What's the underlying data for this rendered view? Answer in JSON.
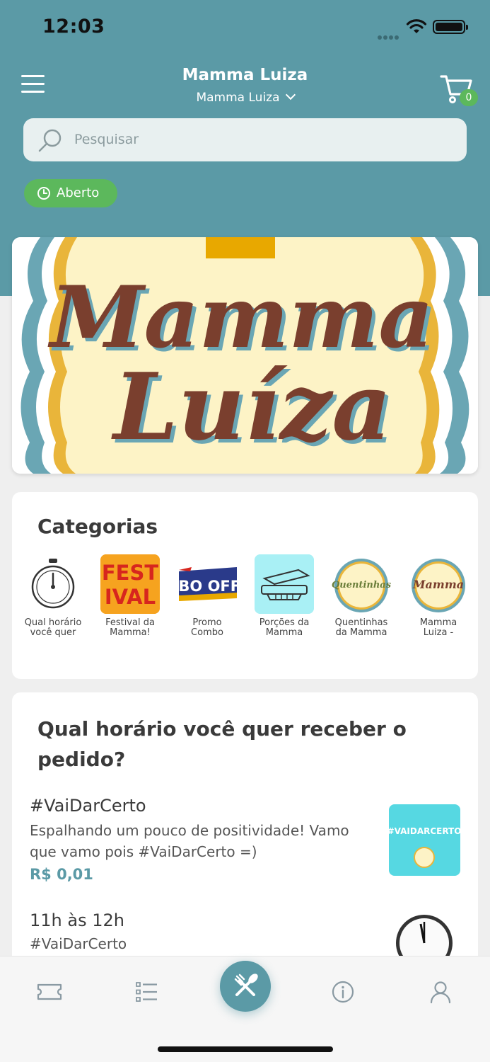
{
  "status_bar": {
    "time": "12:03"
  },
  "header": {
    "title": "Mamma Luiza",
    "store_name": "Mamma Luiza",
    "cart_count": "0"
  },
  "search": {
    "placeholder": "Pesquisar"
  },
  "status_badge": {
    "label": "Aberto"
  },
  "banner": {
    "line1": "Mamma",
    "line2": "Luíza"
  },
  "categories": {
    "title": "Categorias",
    "items": [
      {
        "label_line1": "Qual horário",
        "label_line2": "você quer",
        "icon": "clock-icon"
      },
      {
        "label_line1": "Festival da",
        "label_line2": "Mamma!",
        "icon": "festival-icon",
        "thumb_text1": "FEST",
        "thumb_text2": "IVAL"
      },
      {
        "label_line1": "Promo",
        "label_line2": "Combo",
        "icon": "combo-offer-icon",
        "thumb_text": "MBO OFFE"
      },
      {
        "label_line1": "Porções da",
        "label_line2": "Mamma",
        "icon": "food-container-icon"
      },
      {
        "label_line1": "Quentinhas",
        "label_line2": "da Mamma",
        "icon": "quentinhas-logo-icon",
        "thumb_text": "Quentinhas"
      },
      {
        "label_line1": "Mamma",
        "label_line2": "Luiza -",
        "icon": "mamma-luiza-logo-icon",
        "thumb_text": "Mamma"
      }
    ]
  },
  "menu_section": {
    "title": "Qual horário você quer receber o pedido?",
    "products": [
      {
        "name": "#VaiDarCerto",
        "description": "Espalhando um pouco de positividade! Vamo que vamo pois #VaiDarCerto =)",
        "price": "R$ 0,01",
        "thumb_text": "#VAIDARCERTO"
      },
      {
        "name": "11h às 12h",
        "description": "#VaiDarCerto"
      }
    ]
  },
  "tabbar": {
    "tabs": [
      "ticket-icon",
      "list-icon",
      "cutlery-icon",
      "info-icon",
      "user-icon"
    ]
  },
  "colors": {
    "primary": "#5b9aa6",
    "success": "#5cb85c",
    "banner_bg": "#fdf3c6",
    "brown": "#7a3f2e"
  }
}
